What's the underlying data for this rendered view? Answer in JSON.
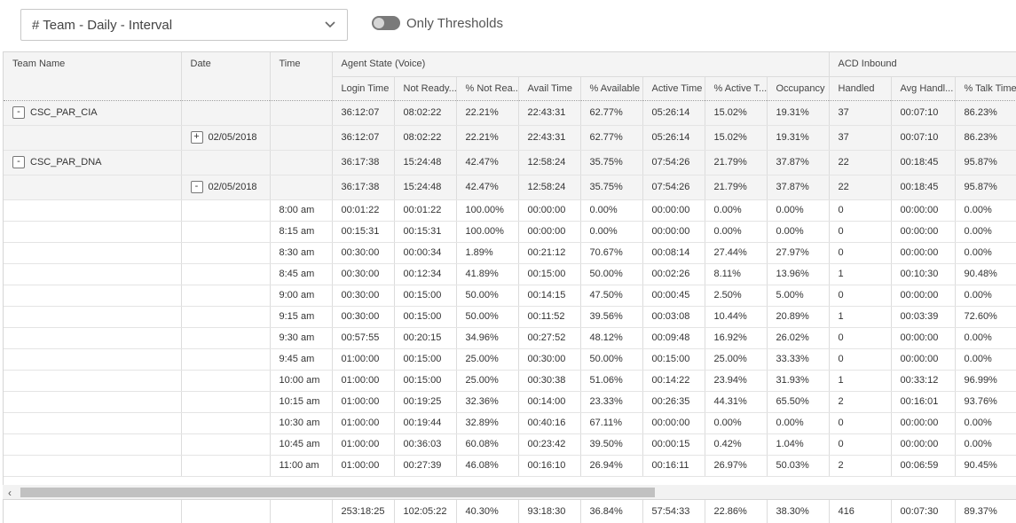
{
  "toolbar": {
    "view_selector": "# Team - Daily - Interval",
    "only_thresholds_label": "Only Thresholds",
    "only_thresholds_on": false
  },
  "table": {
    "columns_fixed": [
      "Team Name",
      "Date",
      "Time"
    ],
    "group_agent": "Agent State (Voice)",
    "group_acd": "ACD Inbound",
    "columns": [
      "Login Time",
      "Not Ready...",
      "% Not Rea...",
      "Avail Time",
      "% Available",
      "Active Time",
      "% Active T...",
      "Occupancy",
      "Handled",
      "Avg Handl...",
      "% Talk Time"
    ],
    "group_rows": [
      {
        "team": "CSC_PAR_CIA",
        "team_expander": "-",
        "date": "",
        "date_expander": "",
        "values": [
          "36:12:07",
          "08:02:22",
          "22.21%",
          "22:43:31",
          "62.77%",
          "05:26:14",
          "15.02%",
          "19.31%",
          "37",
          "00:07:10",
          "86.23%"
        ]
      },
      {
        "team": "",
        "team_expander": "",
        "date": "02/05/2018",
        "date_expander": "+",
        "values": [
          "36:12:07",
          "08:02:22",
          "22.21%",
          "22:43:31",
          "62.77%",
          "05:26:14",
          "15.02%",
          "19.31%",
          "37",
          "00:07:10",
          "86.23%"
        ]
      },
      {
        "team": "CSC_PAR_DNA",
        "team_expander": "-",
        "date": "",
        "date_expander": "",
        "values": [
          "36:17:38",
          "15:24:48",
          "42.47%",
          "12:58:24",
          "35.75%",
          "07:54:26",
          "21.79%",
          "37.87%",
          "22",
          "00:18:45",
          "95.87%"
        ]
      },
      {
        "team": "",
        "team_expander": "",
        "date": "02/05/2018",
        "date_expander": "-",
        "values": [
          "36:17:38",
          "15:24:48",
          "42.47%",
          "12:58:24",
          "35.75%",
          "07:54:26",
          "21.79%",
          "37.87%",
          "22",
          "00:18:45",
          "95.87%"
        ]
      }
    ],
    "detail_rows": [
      {
        "time": "8:00 am",
        "values": [
          "00:01:22",
          "00:01:22",
          "100.00%",
          "00:00:00",
          "0.00%",
          "00:00:00",
          "0.00%",
          "0.00%",
          "0",
          "00:00:00",
          "0.00%"
        ]
      },
      {
        "time": "8:15 am",
        "values": [
          "00:15:31",
          "00:15:31",
          "100.00%",
          "00:00:00",
          "0.00%",
          "00:00:00",
          "0.00%",
          "0.00%",
          "0",
          "00:00:00",
          "0.00%"
        ]
      },
      {
        "time": "8:30 am",
        "values": [
          "00:30:00",
          "00:00:34",
          "1.89%",
          "00:21:12",
          "70.67%",
          "00:08:14",
          "27.44%",
          "27.97%",
          "0",
          "00:00:00",
          "0.00%"
        ]
      },
      {
        "time": "8:45 am",
        "values": [
          "00:30:00",
          "00:12:34",
          "41.89%",
          "00:15:00",
          "50.00%",
          "00:02:26",
          "8.11%",
          "13.96%",
          "1",
          "00:10:30",
          "90.48%"
        ]
      },
      {
        "time": "9:00 am",
        "values": [
          "00:30:00",
          "00:15:00",
          "50.00%",
          "00:14:15",
          "47.50%",
          "00:00:45",
          "2.50%",
          "5.00%",
          "0",
          "00:00:00",
          "0.00%"
        ]
      },
      {
        "time": "9:15 am",
        "values": [
          "00:30:00",
          "00:15:00",
          "50.00%",
          "00:11:52",
          "39.56%",
          "00:03:08",
          "10.44%",
          "20.89%",
          "1",
          "00:03:39",
          "72.60%"
        ]
      },
      {
        "time": "9:30 am",
        "values": [
          "00:57:55",
          "00:20:15",
          "34.96%",
          "00:27:52",
          "48.12%",
          "00:09:48",
          "16.92%",
          "26.02%",
          "0",
          "00:00:00",
          "0.00%"
        ]
      },
      {
        "time": "9:45 am",
        "values": [
          "01:00:00",
          "00:15:00",
          "25.00%",
          "00:30:00",
          "50.00%",
          "00:15:00",
          "25.00%",
          "33.33%",
          "0",
          "00:00:00",
          "0.00%"
        ]
      },
      {
        "time": "10:00 am",
        "values": [
          "01:00:00",
          "00:15:00",
          "25.00%",
          "00:30:38",
          "51.06%",
          "00:14:22",
          "23.94%",
          "31.93%",
          "1",
          "00:33:12",
          "96.99%"
        ]
      },
      {
        "time": "10:15 am",
        "values": [
          "01:00:00",
          "00:19:25",
          "32.36%",
          "00:14:00",
          "23.33%",
          "00:26:35",
          "44.31%",
          "65.50%",
          "2",
          "00:16:01",
          "93.76%"
        ]
      },
      {
        "time": "10:30 am",
        "values": [
          "01:00:00",
          "00:19:44",
          "32.89%",
          "00:40:16",
          "67.11%",
          "00:00:00",
          "0.00%",
          "0.00%",
          "0",
          "00:00:00",
          "0.00%"
        ]
      },
      {
        "time": "10:45 am",
        "values": [
          "01:00:00",
          "00:36:03",
          "60.08%",
          "00:23:42",
          "39.50%",
          "00:00:15",
          "0.42%",
          "1.04%",
          "0",
          "00:00:00",
          "0.00%"
        ]
      },
      {
        "time": "11:00 am",
        "values": [
          "01:00:00",
          "00:27:39",
          "46.08%",
          "00:16:10",
          "26.94%",
          "00:16:11",
          "26.97%",
          "50.03%",
          "2",
          "00:06:59",
          "90.45%"
        ]
      }
    ],
    "totals": [
      "253:18:25",
      "102:05:22",
      "40.30%",
      "93:18:30",
      "36.84%",
      "57:54:33",
      "22.86%",
      "38.30%",
      "416",
      "00:07:30",
      "89.37%"
    ]
  },
  "scroll": {
    "left_arrow": "‹"
  }
}
